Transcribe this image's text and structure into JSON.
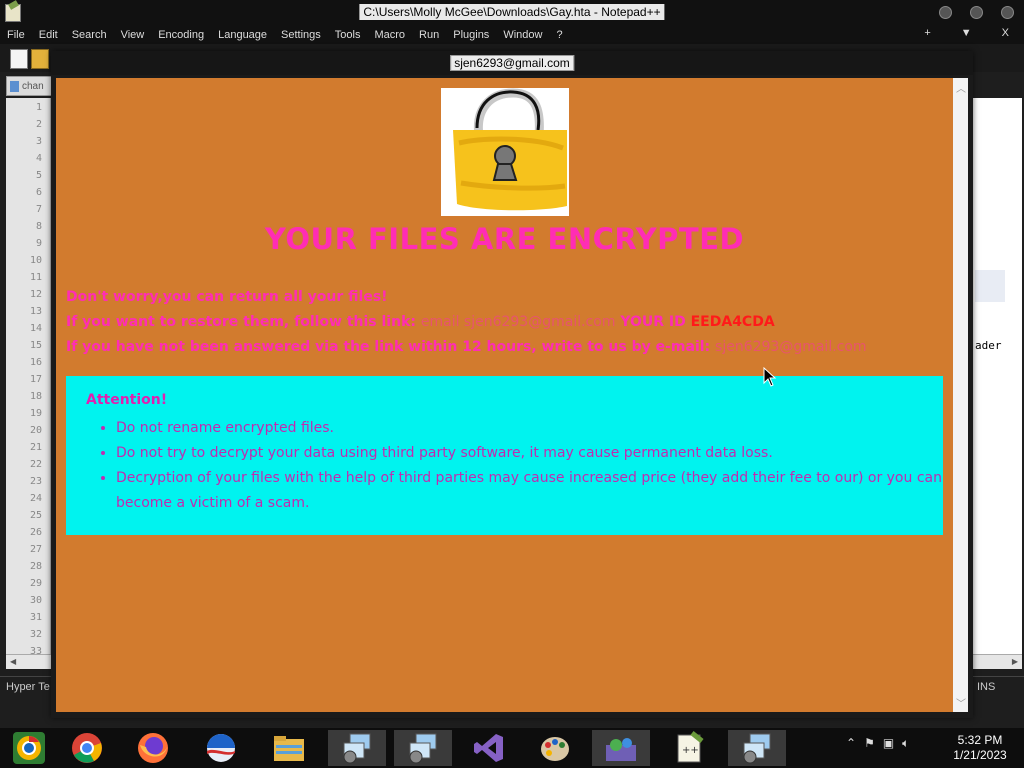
{
  "npp": {
    "title": "C:\\Users\\Molly McGee\\Downloads\\Gay.hta - Notepad++",
    "menu": [
      "File",
      "Edit",
      "Search",
      "View",
      "Encoding",
      "Language",
      "Settings",
      "Tools",
      "Macro",
      "Run",
      "Plugins",
      "Window",
      "?"
    ],
    "menu_right": [
      "+",
      "▼",
      "X"
    ],
    "tab_label": "chan",
    "line_numbers": [
      "1",
      "2",
      "3",
      "4",
      "5",
      "6",
      "7",
      "8",
      "9",
      "10",
      "11",
      "12",
      "13",
      "14",
      "15",
      "16",
      "17",
      "18",
      "19",
      "20",
      "21",
      "22",
      "23",
      "24",
      "25",
      "26",
      "27",
      "28",
      "29",
      "30",
      "31",
      "32",
      "33"
    ],
    "side_text": "ader",
    "status_left": "Hyper Te",
    "status_right": "INS"
  },
  "hta": {
    "window_title": "sjen6293@gmail.com",
    "headline": "YOUR FILES ARE ENCRYPTED",
    "line1": "Don't worry,you can return all your files!",
    "line2_prefix": "If you want to restore them, follow this link:",
    "line2_link": "email sjen6293@gmail.com",
    "line2_id_label": "YOUR ID",
    "line2_id": "EEDA4CDA",
    "line3_prefix": "If you have not been answered via the link within 12 hours, write to us by e-mail:",
    "line3_email": "sjen6293@gmail.com",
    "attention_title": "Attention!",
    "attention_items": [
      "Do not rename encrypted files.",
      "Do not try to decrypt your data using third party software, it may cause permanent data loss.",
      "Decryption of your files with the help of third parties may cause increased price (they add their fee to our) or you can become a victim of a scam."
    ],
    "colors": {
      "background": "#d27b2e",
      "headline": "#ff2db4",
      "id": "#ff1a1a",
      "attention_bg": "#00f3ef"
    }
  },
  "taskbar": {
    "items": [
      "chrome-canary-icon",
      "chrome-icon",
      "firefox-icon",
      "outlook-icon",
      "file-explorer-icon",
      "remote-desktop-icon",
      "remote-desktop-icon",
      "visual-studio-icon",
      "paint-icon",
      "messenger-icon",
      "notepadpp-icon",
      "remote-desktop-icon"
    ],
    "time": "5:32 PM",
    "date": "1/21/2023"
  }
}
